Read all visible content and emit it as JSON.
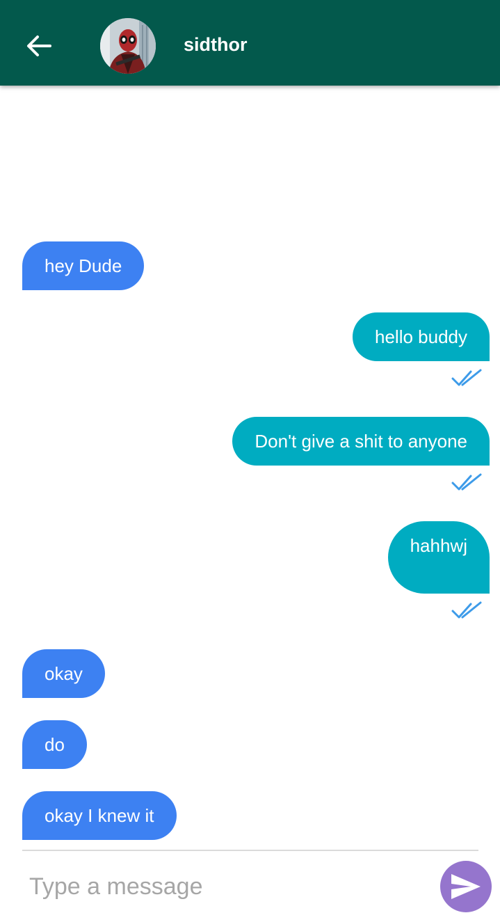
{
  "header": {
    "contact_name": "sidthor",
    "avatar_alt": "sidthor avatar",
    "bar_color": "#03594c"
  },
  "messages": [
    {
      "direction": "incoming",
      "text": "hey Dude"
    },
    {
      "direction": "outgoing",
      "text": "hello buddy",
      "status": "read"
    },
    {
      "direction": "outgoing",
      "text": "Don't give a shit to anyone",
      "status": "read"
    },
    {
      "direction": "outgoing",
      "text": "hahhwj",
      "status": "read"
    },
    {
      "direction": "incoming",
      "text": "okay"
    },
    {
      "direction": "incoming",
      "text": "do"
    },
    {
      "direction": "incoming",
      "text": "okay I knew it"
    }
  ],
  "composer": {
    "value": "",
    "placeholder": "Type a message"
  },
  "icons": {
    "back": "arrow-left-icon",
    "read_status": "double-check-icon",
    "send": "send-icon"
  },
  "colors": {
    "incoming_bubble": "#3d81f2",
    "outgoing_bubble": "#00acc1",
    "read_ticks": "#3d9be9",
    "send_button": "#9575cd"
  }
}
